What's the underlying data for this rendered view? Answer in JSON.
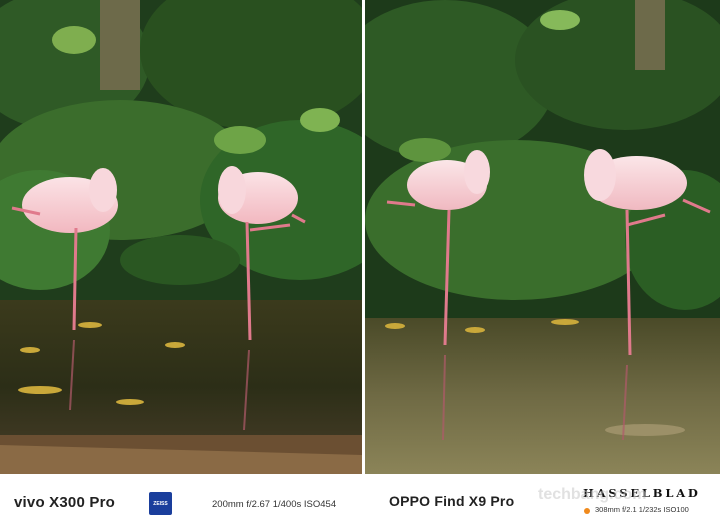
{
  "left": {
    "model": "vivo X300 Pro",
    "lens_brand": "ZEISS",
    "exif": "200mm  f/2.67  1/400s  ISO454"
  },
  "right": {
    "model": "OPPO Find X9 Pro",
    "lens_brand": "HASSELBLAD",
    "exif": "308mm  f/2.1  1/232s  ISO100"
  },
  "watermark": "techbang.com"
}
